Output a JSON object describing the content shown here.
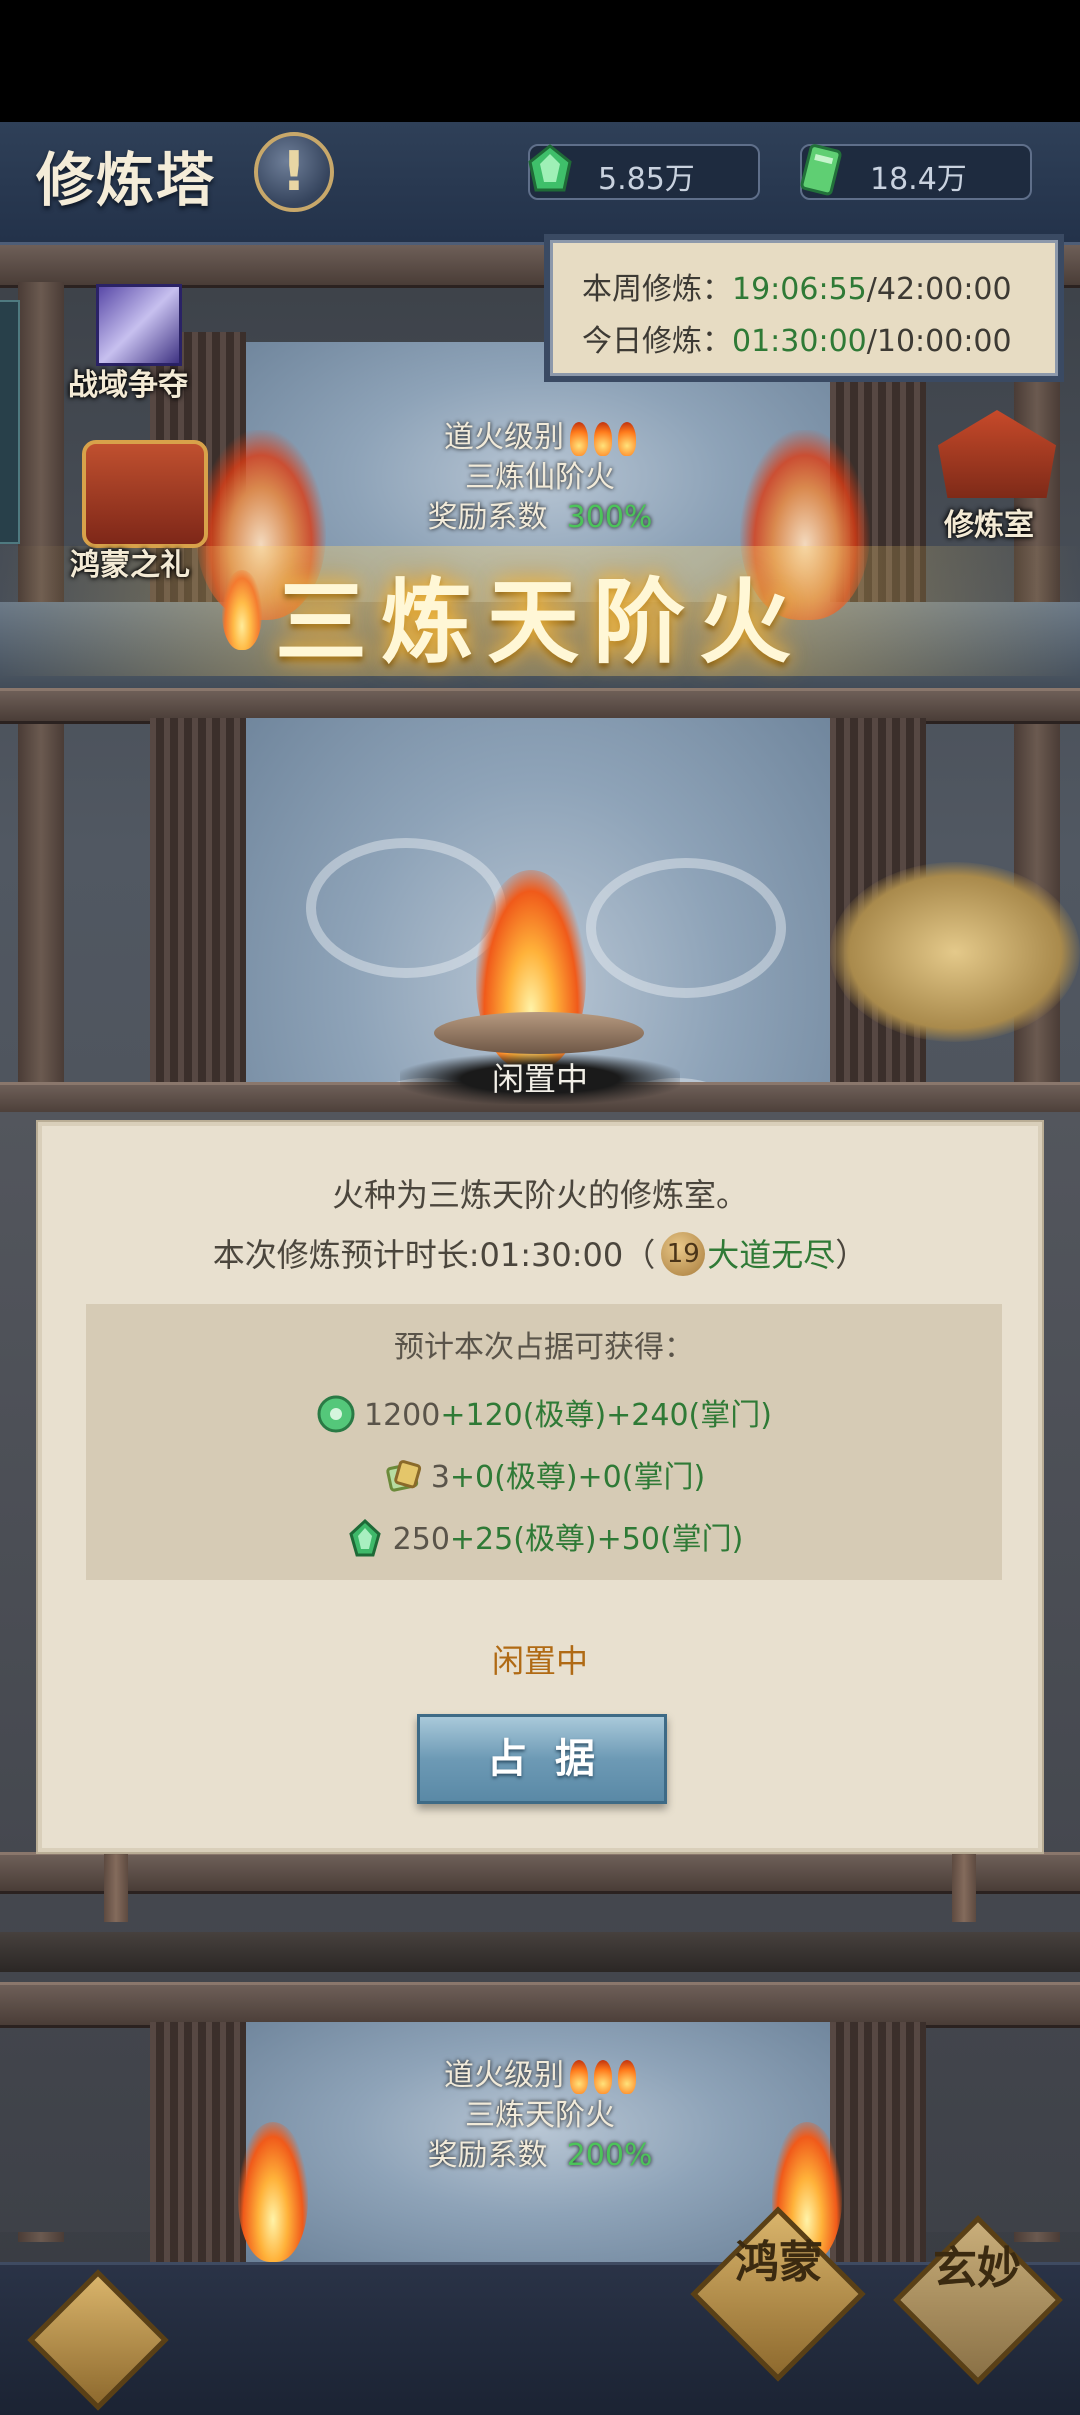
{
  "header": {
    "title": "修炼塔",
    "info_icon": "exclamation-icon",
    "currency_1": {
      "icon": "jade-crystal-icon",
      "value": "5.85万"
    },
    "currency_2": {
      "icon": "jade-scroll-icon",
      "value": "18.4万"
    }
  },
  "timers": {
    "weekly_label": "本周修炼：",
    "weekly_value": "19:06:55",
    "weekly_total": "/42:00:00",
    "daily_label": "今日修炼：",
    "daily_value": "01:30:00",
    "daily_total": "/10:00:00"
  },
  "side_icons": {
    "zone_battle": "战域争夺",
    "hongmeng_gift": "鸿蒙之礼",
    "training_room": "修炼室"
  },
  "floor_upper": {
    "fire_level_label": "道火级别",
    "fire_name": "三炼仙阶火",
    "reward_label": "奖励系数",
    "reward_value": "300%"
  },
  "big_title": "三炼天阶火",
  "idle_label": "闲置中",
  "panel": {
    "description": "火种为三炼天阶火的修炼室。",
    "duration_prefix": "本次修炼预计时长:01:30:00（",
    "duration_badge": "19",
    "duration_suffix_green": "大道无尽",
    "duration_close": "）",
    "rewards_title": "预计本次占据可获得：",
    "rewards": [
      {
        "icon": "jade-coin-icon",
        "base": "1200",
        "bonus": "+120(极尊)+240(掌门)"
      },
      {
        "icon": "scroll-bundle-icon",
        "base": "3",
        "bonus": "+0(极尊)+0(掌门)"
      },
      {
        "icon": "green-crystal-icon",
        "base": "250",
        "bonus": "+25(极尊)+50(掌门)"
      }
    ],
    "status": "闲置中",
    "occupy_button": "占据"
  },
  "floor_lower": {
    "fire_level_label": "道火级别",
    "fire_name": "三炼天阶火",
    "reward_label": "奖励系数",
    "reward_value": "200%"
  },
  "bottom_bar": {
    "left_icon": "cloud-pattern-icon",
    "hongmeng": "鸿蒙",
    "xuanmiao": "玄妙"
  },
  "colors": {
    "accent_green": "#2f7a36",
    "status_orange": "#b06a14",
    "button_blue": "#6d9ab5"
  }
}
